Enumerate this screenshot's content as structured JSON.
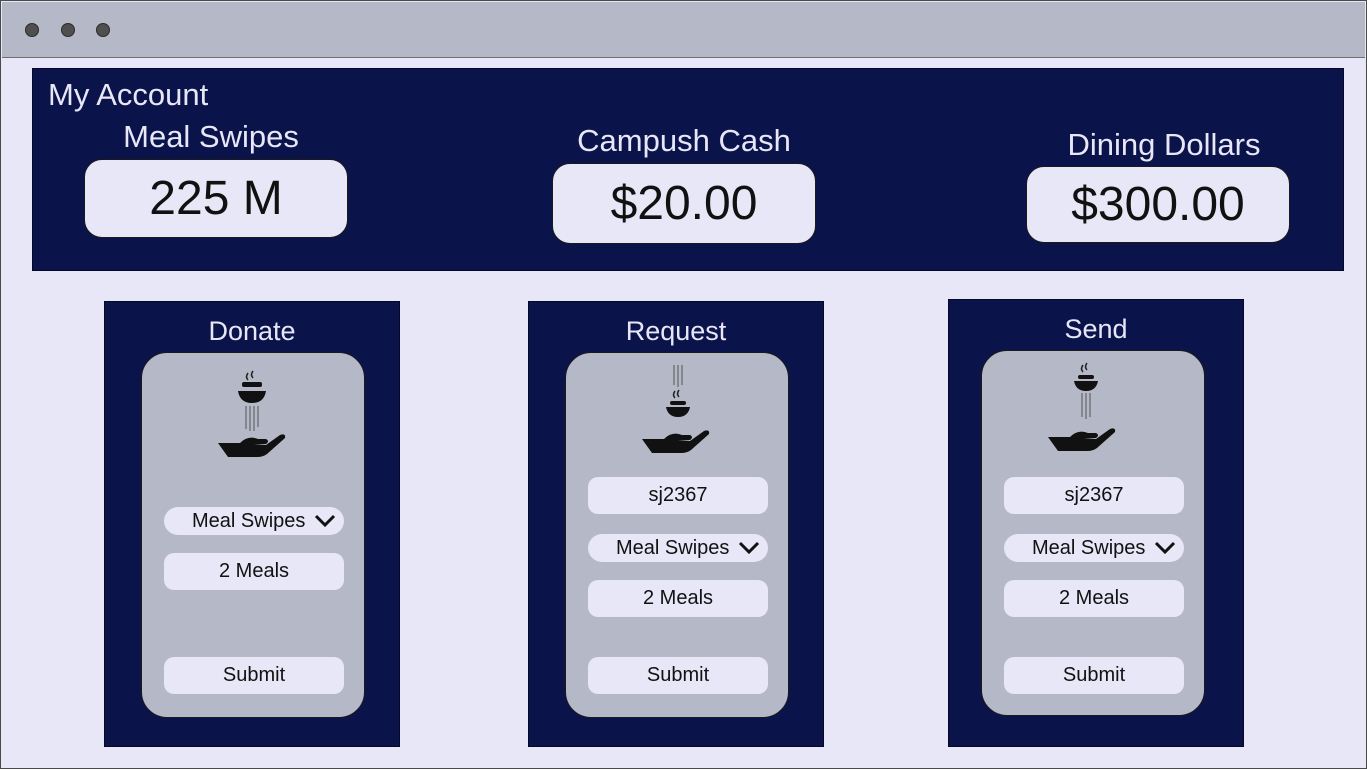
{
  "window": {
    "controls": [
      "close",
      "minimize",
      "maximize"
    ]
  },
  "account": {
    "title": "My Account",
    "balances": [
      {
        "label": "Meal Swipes",
        "value": "225 M"
      },
      {
        "label": "Campush Cash",
        "value": "$20.00"
      },
      {
        "label": "Dining Dollars",
        "value": "$300.00"
      }
    ]
  },
  "panels": {
    "donate": {
      "title": "Donate",
      "icon": "hand-receiving-food-icon",
      "meal_type": "Meal Swipes",
      "amount": "2 Meals",
      "submit": "Submit"
    },
    "request": {
      "title": "Request",
      "icon": "hand-receiving-food-icon",
      "user": "sj2367",
      "meal_type": "Meal Swipes",
      "amount": "2 Meals",
      "submit": "Submit"
    },
    "send": {
      "title": "Send",
      "icon": "hand-receiving-food-icon",
      "user": "sj2367",
      "meal_type": "Meal Swipes",
      "amount": "2 Meals",
      "submit": "Submit"
    }
  },
  "colors": {
    "background": "#e8e7f7",
    "navy": "#0b134b",
    "card_gray": "#b4b8c7",
    "titlebar": "#b4b8c7"
  }
}
